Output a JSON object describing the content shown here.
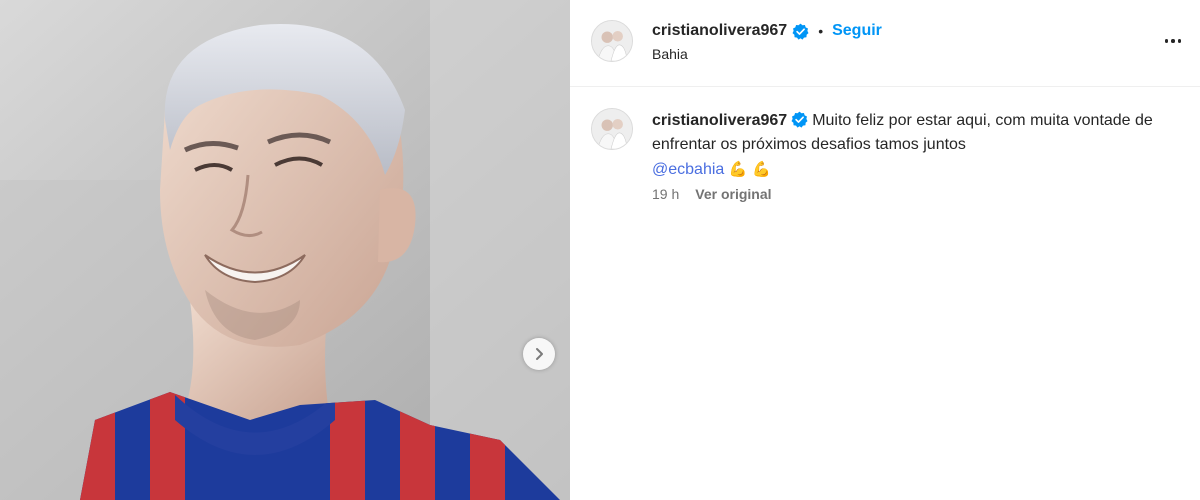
{
  "post": {
    "username": "cristianolivera967",
    "separator": "•",
    "follow_label": "Seguir",
    "location": "Bahia",
    "more_icon": "more-options-icon",
    "caption": {
      "username": "cristianolivera967",
      "text_line": "Muito feliz por estar aqui, com muita vontade de enfrentar os próximos desafios tamos juntos",
      "mention": "@ecbahia",
      "emojis": "💪 💪"
    },
    "time": "19 h",
    "see_original": "Ver original"
  },
  "colors": {
    "accent": "#0095f6",
    "mention": "#4a6ee0",
    "verified": "#0095f6"
  }
}
